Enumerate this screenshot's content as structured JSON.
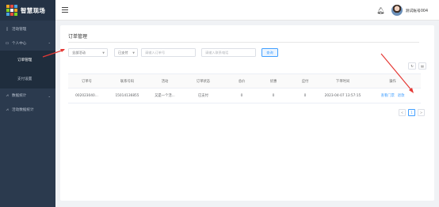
{
  "app": {
    "name": "智慧现场",
    "logo_colors": [
      "#f5a623",
      "#e74c3c",
      "#4aa3df",
      "#7ed321",
      "#ffffff",
      "#f5a623",
      "#4aa3df",
      "#e74c3c",
      "#7ed321"
    ]
  },
  "sidebar": {
    "items": [
      {
        "label": "活动管理",
        "icon": "document-icon"
      },
      {
        "label": "个人中心",
        "icon": "monitor-icon",
        "expanded": true
      },
      {
        "label": "订单管理",
        "active": true
      },
      {
        "label": "支付设置"
      },
      {
        "label": "数据统计",
        "icon": "chart-icon"
      },
      {
        "label": "活动数据统计",
        "icon": "chart-icon"
      }
    ]
  },
  "header": {
    "username": "测试账号004",
    "bell_icon": "bell-icon",
    "menu_icon": "collapse-menu-icon"
  },
  "page": {
    "title": "订单管理",
    "filters": {
      "activity_select": "全部活动",
      "status_select": "已支付",
      "order_no_placeholder": "请输入订单号",
      "phone_placeholder": "请输入联系电话",
      "query_label": "查询"
    },
    "tools": {
      "refresh": "↻",
      "columns": "▤"
    },
    "table": {
      "columns": [
        "订单号",
        "联系号码",
        "活动",
        "订单状态",
        "总价",
        "优惠",
        "应付",
        "下单时间",
        "操作"
      ],
      "rows": [
        {
          "order_no": "002023040...",
          "phone": "15014136855",
          "activity": "又是一个活...",
          "status": "已支付",
          "total": "0",
          "discount": "0",
          "payable": "0",
          "created_at": "2023-04-07 13:57:15",
          "action_view": "查看门票",
          "action_refund": "退款"
        }
      ]
    },
    "pagination": {
      "prev": "<",
      "current": "1",
      "next": ">"
    }
  },
  "annotation_color": "#e53935"
}
